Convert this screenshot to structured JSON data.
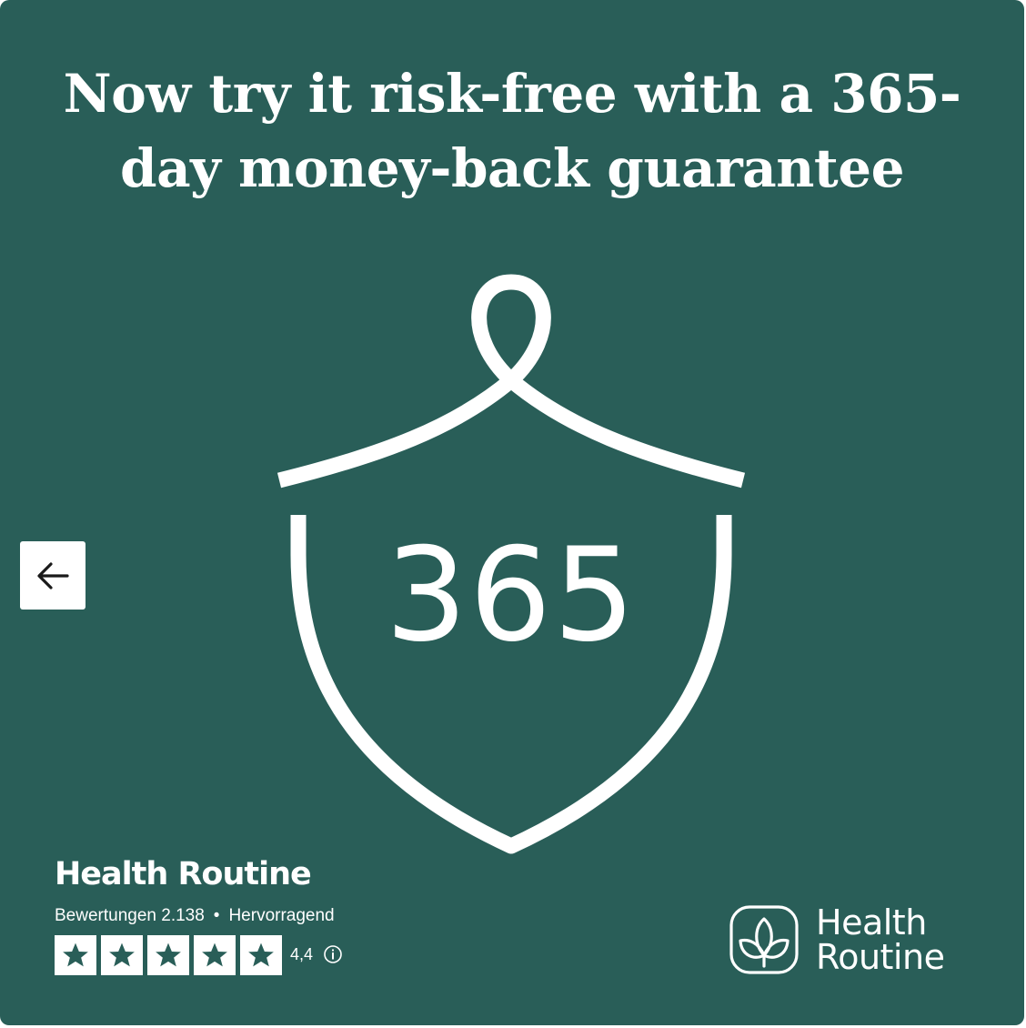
{
  "colors": {
    "background": "#295E58",
    "foreground": "#FFFFFF",
    "star_box": "#FFFFFF",
    "star_glyph": "#295E58",
    "button_bg": "#FFFFFF",
    "button_icon": "#1A1A1A"
  },
  "headline": {
    "line1": "Now try it risk-free with a 365-",
    "line2": "day money-back guarantee"
  },
  "badge": {
    "number": "365",
    "icon": "shield-ribbon-icon"
  },
  "carousel": {
    "prev_icon": "arrow-left-icon"
  },
  "trustpilot": {
    "company": "Health Routine",
    "reviews_text": "Bewertungen 2.138",
    "separator": "•",
    "verdict": "Hervorragend",
    "score": "4,4",
    "stars_filled": 5,
    "stars_total": 5,
    "info_icon": "info-icon"
  },
  "brand": {
    "line1": "Health",
    "line2": "Routine",
    "logo_icon": "health-routine-logo-icon"
  }
}
